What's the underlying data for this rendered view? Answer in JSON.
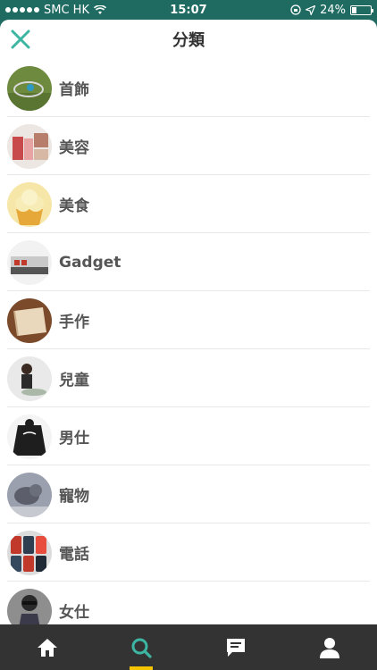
{
  "status_bar": {
    "carrier": "SMC HK",
    "time": "15:07",
    "battery": "24%",
    "battery_level": 0.24
  },
  "header": {
    "title": "分類",
    "close_icon": "close-icon"
  },
  "categories": [
    {
      "label": "首飾",
      "thumb": "bracelet"
    },
    {
      "label": "美容",
      "thumb": "cosmetics"
    },
    {
      "label": "美食",
      "thumb": "cupcake"
    },
    {
      "label": "Gadget",
      "thumb": "console"
    },
    {
      "label": "手作",
      "thumb": "leather-notebook"
    },
    {
      "label": "兒童",
      "thumb": "child"
    },
    {
      "label": "男仕",
      "thumb": "jacket"
    },
    {
      "label": "寵物",
      "thumb": "pet"
    },
    {
      "label": "電話",
      "thumb": "phone-cases"
    },
    {
      "label": "女仕",
      "thumb": "woman"
    }
  ],
  "tabbar": {
    "tabs": [
      {
        "icon": "home-icon",
        "active": false
      },
      {
        "icon": "search-icon",
        "active": true
      },
      {
        "icon": "chat-icon",
        "active": false
      },
      {
        "icon": "profile-icon",
        "active": false
      }
    ]
  },
  "colors": {
    "brand": "#1f6b62",
    "accent": "#3cb6a3",
    "active_tab_indicator": "#f5c400",
    "tabbar": "#333333"
  }
}
